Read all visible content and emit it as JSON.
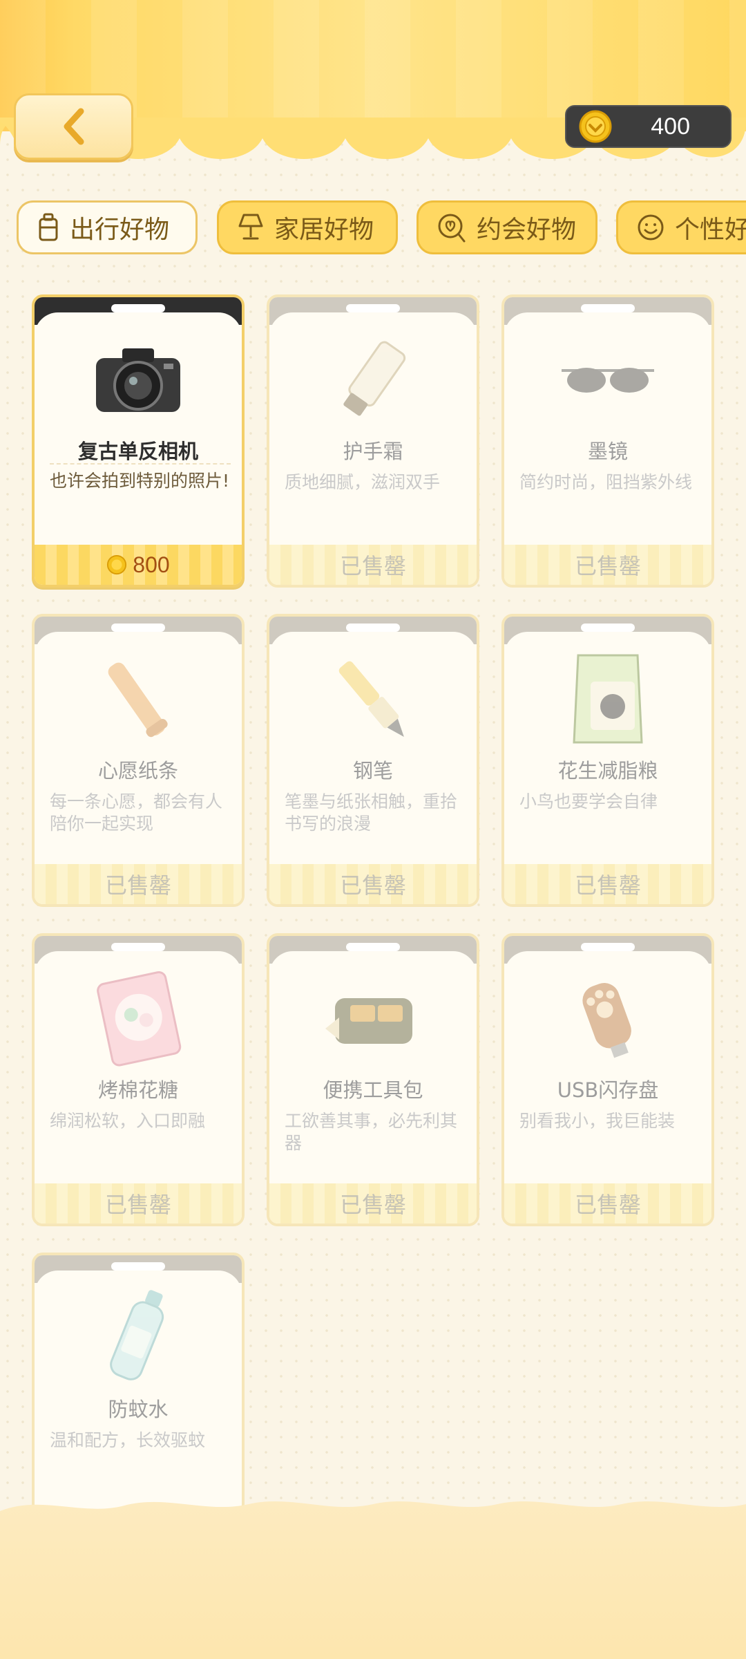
{
  "header": {
    "back_icon": "chevron-left-icon",
    "coin_icon": "coin-icon",
    "coins": "400"
  },
  "tabs": [
    {
      "label": "出行好物",
      "icon": "suitcase-icon",
      "active": true
    },
    {
      "label": "家居好物",
      "icon": "lamp-icon",
      "active": false
    },
    {
      "label": "约会好物",
      "icon": "heart-balloon-icon",
      "active": false
    },
    {
      "label": "个性好",
      "icon": "smiley-icon",
      "active": false
    }
  ],
  "items": [
    {
      "name": "复古单反相机",
      "desc": "也许会拍到特别的照片!",
      "status": "",
      "price": "800",
      "icon": "camera-icon",
      "featured": true
    },
    {
      "name": "护手霜",
      "desc": "质地细腻，滋润双手",
      "status": "已售罄",
      "icon": "hand-cream-icon"
    },
    {
      "name": "墨镜",
      "desc": "简约时尚，阻挡紫外线",
      "status": "已售罄",
      "icon": "sunglasses-icon"
    },
    {
      "name": "心愿纸条",
      "desc": "每一条心愿，都会有人陪你一起实现",
      "status": "已售罄",
      "icon": "paper-scroll-icon"
    },
    {
      "name": "钢笔",
      "desc": "笔墨与纸张相触，重拾书写的浪漫",
      "status": "已售罄",
      "icon": "fountain-pen-icon"
    },
    {
      "name": "花生减脂粮",
      "desc": "小鸟也要学会自律",
      "status": "已售罄",
      "icon": "snack-bag-icon"
    },
    {
      "name": "烤棉花糖",
      "desc": "绵润松软，入口即融",
      "status": "已售罄",
      "icon": "marshmallow-bag-icon"
    },
    {
      "name": "便携工具包",
      "desc": "工欲善其事，必先利其器",
      "status": "已售罄",
      "icon": "tool-pouch-icon"
    },
    {
      "name": "USB闪存盘",
      "desc": "别看我小，我巨能装",
      "status": "已售罄",
      "icon": "usb-paw-icon"
    },
    {
      "name": "防蚊水",
      "desc": "温和配方，长效驱蚊",
      "status": "",
      "icon": "spray-bottle-icon"
    }
  ],
  "colors": {
    "accent": "#ffd862",
    "featured_top": "#2f2f2f",
    "sold_text": "#c6c3b6"
  }
}
